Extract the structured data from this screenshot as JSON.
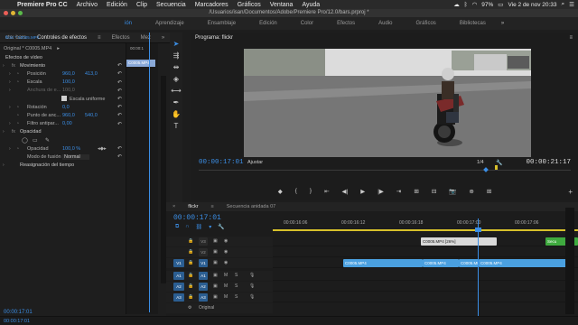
{
  "menubar": {
    "app_name": "Premiere Pro CC",
    "items": [
      "Archivo",
      "Edición",
      "Clip",
      "Secuencia",
      "Marcadores",
      "Gráficos",
      "Ventana",
      "Ayuda"
    ],
    "battery": "97%",
    "clock": "Vie 2 de nov  20:33"
  },
  "titlebar": {
    "path": "/Usuarios/isan/Documentos/Adobe/Premiere Pro/12.0/bars.prproj *"
  },
  "workspaces": {
    "items": [
      "ión",
      "Aprendizaje",
      "Ensamblaje",
      "Edición",
      "Color",
      "Efectos",
      "Audio",
      "Gráficos",
      "Bibliotecas"
    ],
    "active_index": 0,
    "more": "»"
  },
  "effect_controls": {
    "tabs": [
      "cto: bars",
      "Controles de efectos",
      "Efectos",
      "Mez",
      "»"
    ],
    "active_tab": 1,
    "source_label": "Original * C0005.MP4",
    "clip_label": "flickr * C0005.MP4",
    "mini_timecode": "00:00:1",
    "mini_clip": "C0005.MP4",
    "section_video": "Efectos de vídeo",
    "rows": [
      {
        "label": "Movimiento",
        "v1": "",
        "v2": "",
        "kind": "group"
      },
      {
        "label": "Posición",
        "v1": "960,0",
        "v2": "413,0",
        "kind": "prop"
      },
      {
        "label": "Escala",
        "v1": "100,0",
        "v2": "",
        "kind": "prop"
      },
      {
        "label": "Anchura de e...",
        "v1": "100,0",
        "v2": "",
        "kind": "prop-dim"
      },
      {
        "label": "Escala uniforme",
        "v1": "",
        "v2": "",
        "kind": "check"
      },
      {
        "label": "Rotación",
        "v1": "0,0",
        "v2": "",
        "kind": "prop"
      },
      {
        "label": "Punto de anc...",
        "v1": "960,0",
        "v2": "540,0",
        "kind": "prop"
      },
      {
        "label": "Filtro antipar...",
        "v1": "0,00",
        "v2": "",
        "kind": "prop"
      },
      {
        "label": "Opacidad",
        "v1": "",
        "v2": "",
        "kind": "group"
      },
      {
        "label": "",
        "v1": "",
        "v2": "",
        "kind": "masks"
      },
      {
        "label": "Opacidad",
        "v1": "100,0 %",
        "v2": "",
        "kind": "prop"
      },
      {
        "label": "Modo de fusión",
        "v1": "Normal",
        "v2": "",
        "kind": "select"
      },
      {
        "label": "Reasignación del tiempo",
        "v1": "",
        "v2": "",
        "kind": "group"
      }
    ],
    "timecode": "00:00:17:01"
  },
  "tools": [
    "selection-tool",
    "track-select-tool",
    "ripple-edit-tool",
    "razor-tool",
    "slip-tool",
    "pen-tool",
    "hand-tool",
    "type-tool"
  ],
  "program_monitor": {
    "title": "Programa: flickr",
    "menu": "≡",
    "timecode_left": "00:00:17:01",
    "fit": "Ajustar",
    "resolution": "1/4",
    "timecode_right": "00:00:21:17",
    "transport": [
      "◆",
      "{",
      "}",
      "⇤",
      "◀|",
      "▶",
      "|▶",
      "⇥",
      "⊞",
      "⊟",
      "📷",
      "⊕",
      "⊞"
    ]
  },
  "timeline": {
    "tabs": [
      "flickr",
      "Secuencia anidada 07"
    ],
    "active_tab": 0,
    "timecode": "00:00:17:01",
    "ruler": [
      "00:00:16:06",
      "00:00:16:12",
      "00:00:16:18",
      "00:00:17:00",
      "00:00:17:06"
    ],
    "tracks": [
      {
        "id": "V3",
        "type": "video",
        "patch": ""
      },
      {
        "id": "V2",
        "type": "video",
        "patch": ""
      },
      {
        "id": "V1",
        "type": "video",
        "patch": "V1"
      },
      {
        "id": "A1",
        "type": "audio",
        "patch": "A1"
      },
      {
        "id": "A2",
        "type": "audio",
        "patch": "A2"
      },
      {
        "id": "A3",
        "type": "audio",
        "patch": "A3"
      }
    ],
    "clips": {
      "v3_label": "C0005.MP4 [26%]",
      "v3_green": "Secu",
      "v1_a": "C0005.MP4",
      "v1_b": "C0005.MP4",
      "v1_c": "C0005.MP4",
      "v1_d": "C0005.MP4"
    },
    "original_label": "Original"
  },
  "status": {
    "timecode": "00:00:17:01"
  }
}
